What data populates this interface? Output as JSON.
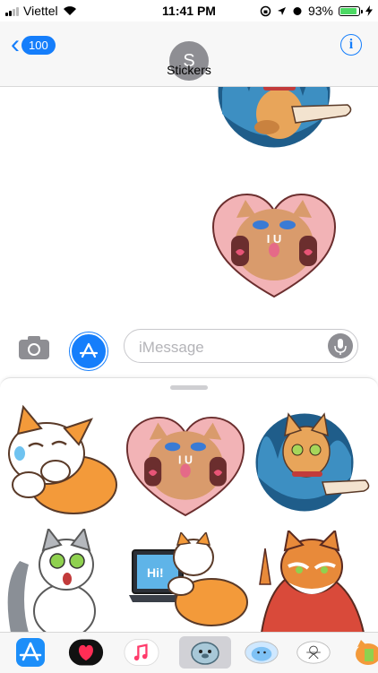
{
  "status_bar": {
    "carrier": "Viettel",
    "time": "11:41 PM",
    "battery_percent": "93%",
    "battery_level": 0.93
  },
  "nav": {
    "back_badge": "100",
    "avatar_letter": "S",
    "contact_name": "Stickers",
    "info_label": "i"
  },
  "composer": {
    "placeholder": "iMessage"
  },
  "sticker_grid": {
    "items": [
      "Crying orange-white cat",
      "I U cat heart",
      "Cat peeking curtain",
      "Shocked grey-white cat",
      "Cat with laptop Hi!",
      "Wise old cat in robe"
    ],
    "laptop_text": "Hi!",
    "heart_text": "I U"
  },
  "tray": {
    "items": [
      "App Store",
      "Heart",
      "Music",
      "Seal sticker pack",
      "Blue blob pack",
      "Drawing pack",
      "Cat pack"
    ],
    "selected_index": 3
  },
  "colors": {
    "accent": "#157efb",
    "battery": "#4cd964"
  }
}
